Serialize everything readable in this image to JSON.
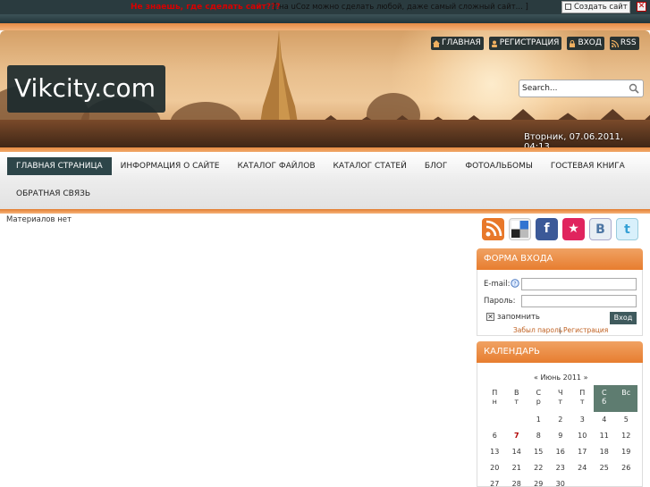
{
  "topbar": {
    "promo_link": "Не знаешь, где сделать сайт???",
    "promo_text": "[ на uCoz можно сделать любой, даже самый сложный сайт... ]",
    "create_button": "Создать сайт",
    "close_glyph": "✕"
  },
  "header": {
    "logo": "Vikcity.com",
    "links": [
      {
        "label": "Главная",
        "icon": "home-icon"
      },
      {
        "label": "Регистрация",
        "icon": "user-icon"
      },
      {
        "label": "Вход",
        "icon": "lock-icon"
      },
      {
        "label": "RSS",
        "icon": "rss-icon"
      }
    ],
    "search_placeholder": "Search...",
    "search_value": "Search...",
    "date": "Вторник, 07.06.2011, 04:13"
  },
  "nav": {
    "row1": [
      "Главная страница",
      "Информация о сайте",
      "Каталог файлов",
      "Каталог статей",
      "Блог",
      "Фотоальбомы",
      "Гостевая книга"
    ],
    "row2": [
      "Обратная связь"
    ]
  },
  "content": {
    "no_materials": "Материалов нет"
  },
  "social": [
    {
      "name": "rss-icon",
      "glyph": "",
      "color": "#e8782a"
    },
    {
      "name": "delicious-icon",
      "glyph": "",
      "color": "#333333"
    },
    {
      "name": "facebook-icon",
      "glyph": "f",
      "color": "#3b5998"
    },
    {
      "name": "favorites-icon",
      "glyph": "★",
      "color": "#e0245e"
    },
    {
      "name": "vkontakte-icon",
      "glyph": "B",
      "color": "#4c75a3"
    },
    {
      "name": "twitter-icon",
      "glyph": "t",
      "color": "#33b5e5"
    }
  ],
  "login": {
    "title": "Форма входа",
    "email_label": "E-mail:",
    "password_label": "Пароль:",
    "remember_label": "запомнить",
    "submit_label": "Вход",
    "forgot_link": "Забыл пароль",
    "separator": "|",
    "register_link": "Регистрация"
  },
  "calendar": {
    "title": "Календарь",
    "prev": "«",
    "month": "Июнь 2011",
    "next": "»",
    "weekdays": [
      "П\nн",
      "В\nт",
      "С\nр",
      "Ч\nт",
      "П\nт",
      "С\nб",
      "Вс"
    ],
    "weeks": [
      [
        "",
        "",
        "1",
        "2",
        "3",
        "4",
        "5"
      ],
      [
        "6",
        "7",
        "8",
        "9",
        "10",
        "11",
        "12"
      ],
      [
        "13",
        "14",
        "15",
        "16",
        "17",
        "18",
        "19"
      ],
      [
        "20",
        "21",
        "22",
        "23",
        "24",
        "25",
        "26"
      ],
      [
        "27",
        "28",
        "29",
        "30",
        "",
        "",
        ""
      ]
    ],
    "today": "7"
  }
}
